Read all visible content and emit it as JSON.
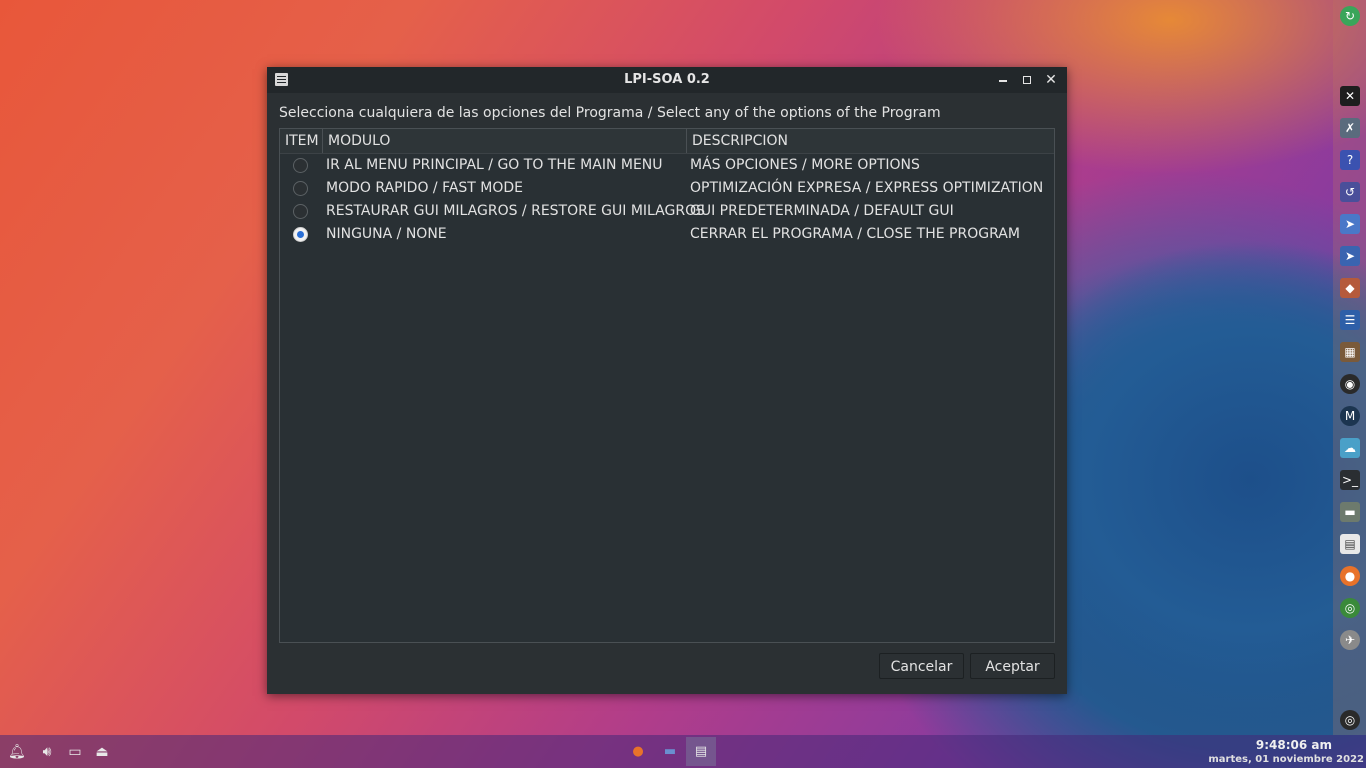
{
  "window": {
    "title": "LPI-SOA 0.2",
    "instruction": "Selecciona cualquiera de las opciones del Programa / Select any of the options of the Program",
    "columns": [
      "ITEM",
      "MODULO",
      "DESCRIPCION"
    ],
    "rows": [
      {
        "module": "IR AL MENU PRINCIPAL / GO TO THE MAIN MENU",
        "description": "MÁS OPCIONES / MORE OPTIONS",
        "selected": false
      },
      {
        "module": "MODO RAPIDO / FAST MODE",
        "description": "OPTIMIZACIÓN EXPRESA / EXPRESS OPTIMIZATION",
        "selected": false
      },
      {
        "module": "RESTAURAR GUI MILAGROS / RESTORE GUI MILAGROS",
        "description": "GUI PREDETERMINADA / DEFAULT GUI",
        "selected": false
      },
      {
        "module": "NINGUNA / NONE",
        "description": "CERRAR EL PROGRAMA / CLOSE THE PROGRAM",
        "selected": true
      }
    ],
    "buttons": {
      "cancel": "Cancelar",
      "accept": "Aceptar"
    }
  },
  "dock": {
    "items": [
      "update-icon",
      "close-x-icon",
      "tools-icon",
      "app-icon",
      "app-icon",
      "cursor-icon",
      "cursor-icon",
      "app-icon",
      "editor-icon",
      "grid-icon",
      "app-icon",
      "m-icon",
      "cloud-icon",
      "terminal-icon",
      "drawer-icon",
      "document-icon",
      "firefox-icon",
      "chrome-icon",
      "rocket-icon",
      "os-icon"
    ]
  },
  "panel": {
    "clock_time": "9:48:06 am",
    "clock_date": "martes, 01 noviembre 2022"
  }
}
